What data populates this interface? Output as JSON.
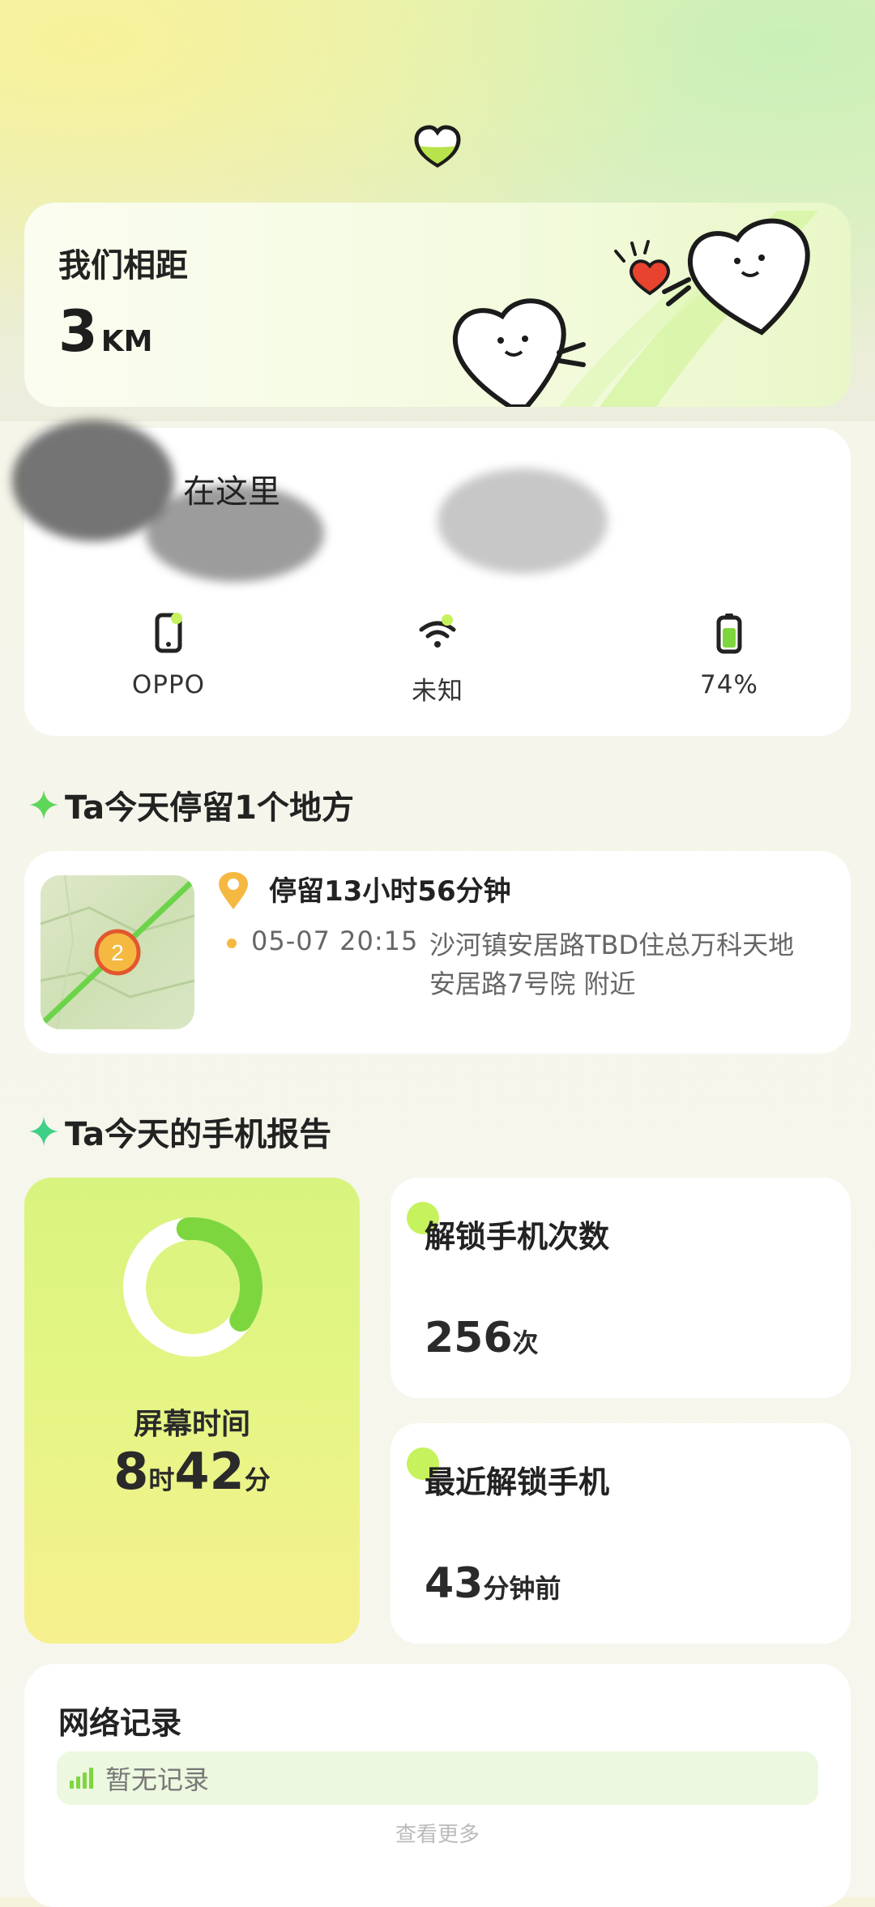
{
  "distance": {
    "title": "我们相距",
    "value": "3",
    "unit": "KM"
  },
  "location": {
    "here_text": "在这里",
    "device": "OPPO",
    "network": "未知",
    "battery": "74%"
  },
  "stay_section": {
    "heading": "Ta今天停留1个地方",
    "map_count": "2",
    "duration": "停留13小时56分钟",
    "time": "05-07 20:15",
    "address": "沙河镇安居路TBD住总万科天地安居路7号院 附近"
  },
  "report_section": {
    "heading": "Ta今天的手机报告",
    "screen_time": {
      "label": "屏幕时间",
      "hours": "8",
      "hours_unit": "时",
      "minutes": "42",
      "minutes_unit": "分",
      "fraction_of_day": 0.36
    },
    "unlock_count": {
      "label": "解锁手机次数",
      "value": "256",
      "unit": "次"
    },
    "last_unlock": {
      "label": "最近解锁手机",
      "value": "43",
      "unit": "分钟前"
    }
  },
  "network_section": {
    "title": "网络记录",
    "empty_text": "暂无记录",
    "more": "查看更多"
  },
  "colors": {
    "accent_green": "#7ed63f",
    "accent_lime": "#c6f25d",
    "pin": "#f5b942"
  }
}
